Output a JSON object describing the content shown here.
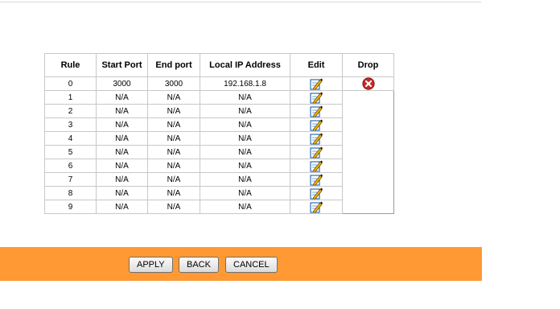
{
  "table": {
    "headers": [
      "Rule",
      "Start Port",
      "End port",
      "Local IP Address",
      "Edit",
      "Drop"
    ],
    "rows": [
      {
        "rule": "0",
        "start_port": "3000",
        "end_port": "3000",
        "local_ip": "192.168.1.8",
        "edit_icon": "edit-pencil-icon",
        "drop_icon": "delete-x-icon"
      },
      {
        "rule": "1",
        "start_port": "N/A",
        "end_port": "N/A",
        "local_ip": "N/A",
        "edit_icon": "edit-pencil-icon"
      },
      {
        "rule": "2",
        "start_port": "N/A",
        "end_port": "N/A",
        "local_ip": "N/A",
        "edit_icon": "edit-pencil-icon"
      },
      {
        "rule": "3",
        "start_port": "N/A",
        "end_port": "N/A",
        "local_ip": "N/A",
        "edit_icon": "edit-pencil-icon"
      },
      {
        "rule": "4",
        "start_port": "N/A",
        "end_port": "N/A",
        "local_ip": "N/A",
        "edit_icon": "edit-pencil-icon"
      },
      {
        "rule": "5",
        "start_port": "N/A",
        "end_port": "N/A",
        "local_ip": "N/A",
        "edit_icon": "edit-pencil-icon"
      },
      {
        "rule": "6",
        "start_port": "N/A",
        "end_port": "N/A",
        "local_ip": "N/A",
        "edit_icon": "edit-pencil-icon"
      },
      {
        "rule": "7",
        "start_port": "N/A",
        "end_port": "N/A",
        "local_ip": "N/A",
        "edit_icon": "edit-pencil-icon"
      },
      {
        "rule": "8",
        "start_port": "N/A",
        "end_port": "N/A",
        "local_ip": "N/A",
        "edit_icon": "edit-pencil-icon"
      },
      {
        "rule": "9",
        "start_port": "N/A",
        "end_port": "N/A",
        "local_ip": "N/A",
        "edit_icon": "edit-pencil-icon"
      }
    ]
  },
  "footer": {
    "apply_label": "APPLY",
    "back_label": "BACK",
    "cancel_label": "CANCEL",
    "background_color": "#ff9933"
  },
  "colors": {
    "drop_icon": "#c62828",
    "edit_icon_pad": "#2f6db5",
    "edit_icon_pencil": "#f2b705"
  }
}
